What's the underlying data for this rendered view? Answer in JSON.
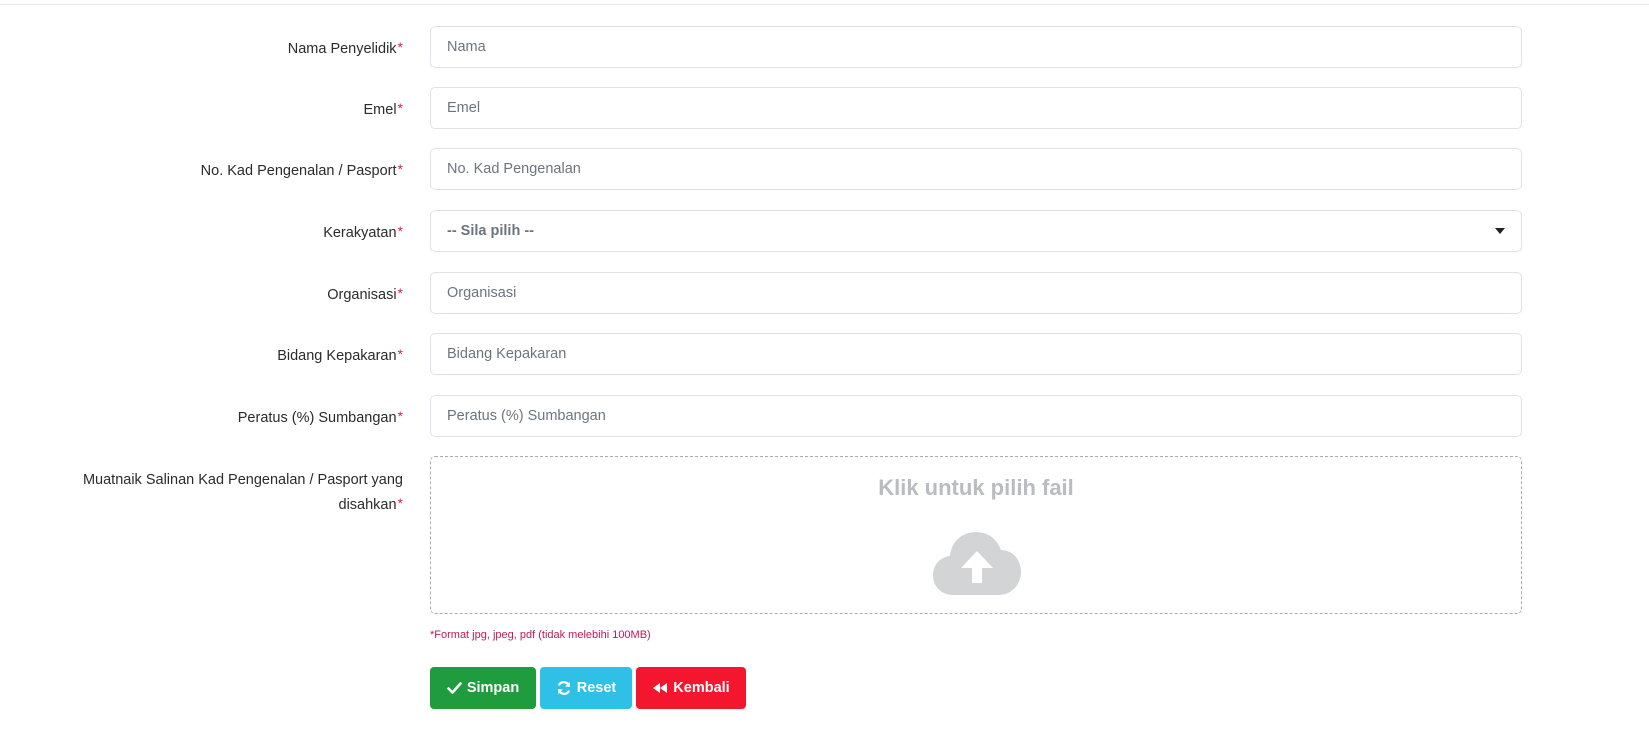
{
  "form": {
    "required_marker": "*",
    "fields": {
      "nama_penyelidik": {
        "label": "Nama Penyelidik",
        "placeholder": "Nama",
        "value": ""
      },
      "emel": {
        "label": "Emel",
        "placeholder": "Emel",
        "value": ""
      },
      "no_kad": {
        "label": "No. Kad Pengenalan / Pasport",
        "placeholder": "No. Kad Pengenalan",
        "value": ""
      },
      "kerakyatan": {
        "label": "Kerakyatan",
        "selected": "-- Sila pilih --"
      },
      "organisasi": {
        "label": "Organisasi",
        "placeholder": "Organisasi",
        "value": ""
      },
      "bidang": {
        "label": "Bidang Kepakaran",
        "placeholder": "Bidang Kepakaran",
        "value": ""
      },
      "peratus": {
        "label": "Peratus (%) Sumbangan",
        "placeholder": "Peratus (%) Sumbangan",
        "value": ""
      }
    },
    "upload": {
      "label": "Muatnaik Salinan Kad Pengenalan / Pasport yang disahkan",
      "dropzone_text": "Klik untuk pilih fail",
      "icon": "cloud-upload-icon",
      "hint": "*Format jpg, jpeg, pdf (tidak melebihi 100MB)"
    },
    "buttons": {
      "save": {
        "label": "Simpan",
        "icon": "check-icon",
        "color": "#1f9d3e"
      },
      "reset": {
        "label": "Reset",
        "icon": "refresh-icon",
        "color": "#2ec0e6"
      },
      "back": {
        "label": "Kembali",
        "icon": "double-chevron-left-icon",
        "color": "#f4162f"
      }
    }
  }
}
